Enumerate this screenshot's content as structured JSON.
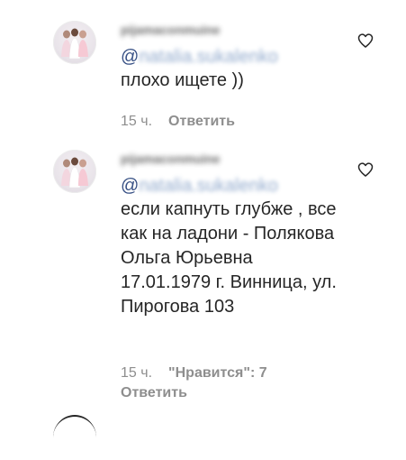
{
  "comments": [
    {
      "username": "pijamaconmuine",
      "mention_at": "@",
      "mention_name": "natalia.sukalenko",
      "text": "плохо ищете ))",
      "time": "15 ч.",
      "likes": "",
      "reply_label": "Ответить"
    },
    {
      "username": "pijamaconmuine",
      "mention_at": "@",
      "mention_name": "natalia.sukalenko",
      "text": "если капнуть глубже , все как на ладони - Полякова Ольга Юрьевна 17.01.1979 г. Винница, ул. Пирогова 103",
      "time": "15 ч.",
      "likes": "\"Нравится\": 7",
      "reply_label": "Ответить"
    }
  ],
  "icons": {
    "like": "heart-outline-icon",
    "avatar": "user-avatar"
  },
  "colors": {
    "text": "#262626",
    "meta": "#8e8e8e",
    "mention": "#385185"
  }
}
